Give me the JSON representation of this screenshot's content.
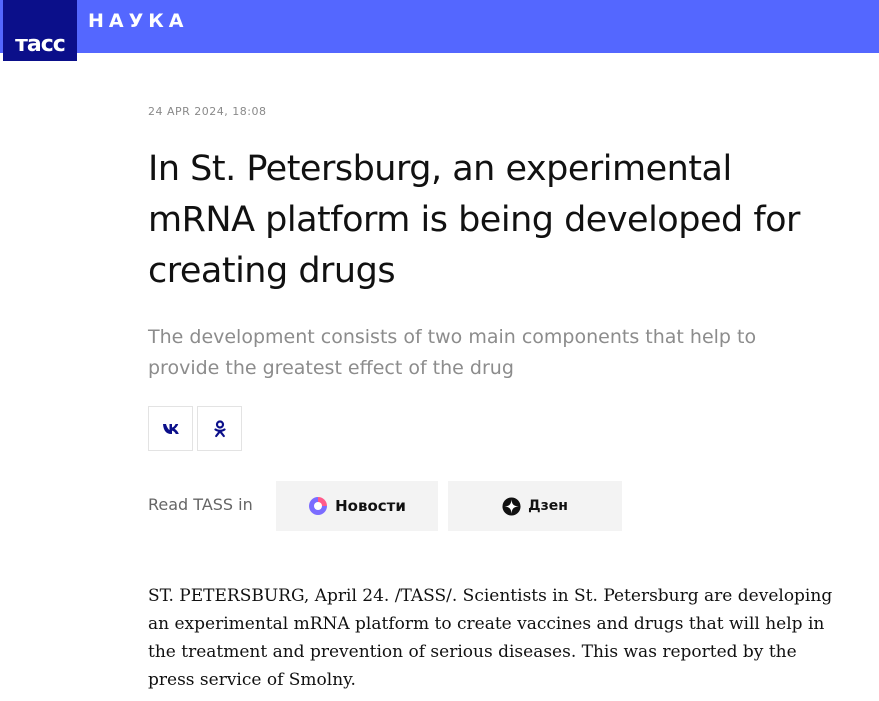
{
  "header": {
    "logo_text": "тасс",
    "section": "НАУКА",
    "bar_color": "#5467ff",
    "logo_color": "#0b0f8a"
  },
  "article": {
    "date": "24 APR 2024, 18:08",
    "headline": "In St. Petersburg, an experimental mRNA platform is being developed for creating drugs",
    "lead": "The development consists of two main components that help to provide the greatest effect of the drug",
    "body": "ST. PETERSBURG, April 24. /TASS/. Scientists in St. Petersburg are developing an experimental mRNA platform to create vaccines and drugs that will help in the treatment and prevention of serious diseases. This was reported by the press service of Smolny."
  },
  "share": {
    "buttons": [
      {
        "icon": "vk-icon"
      },
      {
        "icon": "odnoklassniki-icon"
      }
    ]
  },
  "read_in": {
    "label": "Read TASS in",
    "apps": [
      {
        "label": "Новости",
        "icon": "novosti-icon"
      },
      {
        "label": "Дзен",
        "icon": "dzen-icon"
      }
    ]
  }
}
